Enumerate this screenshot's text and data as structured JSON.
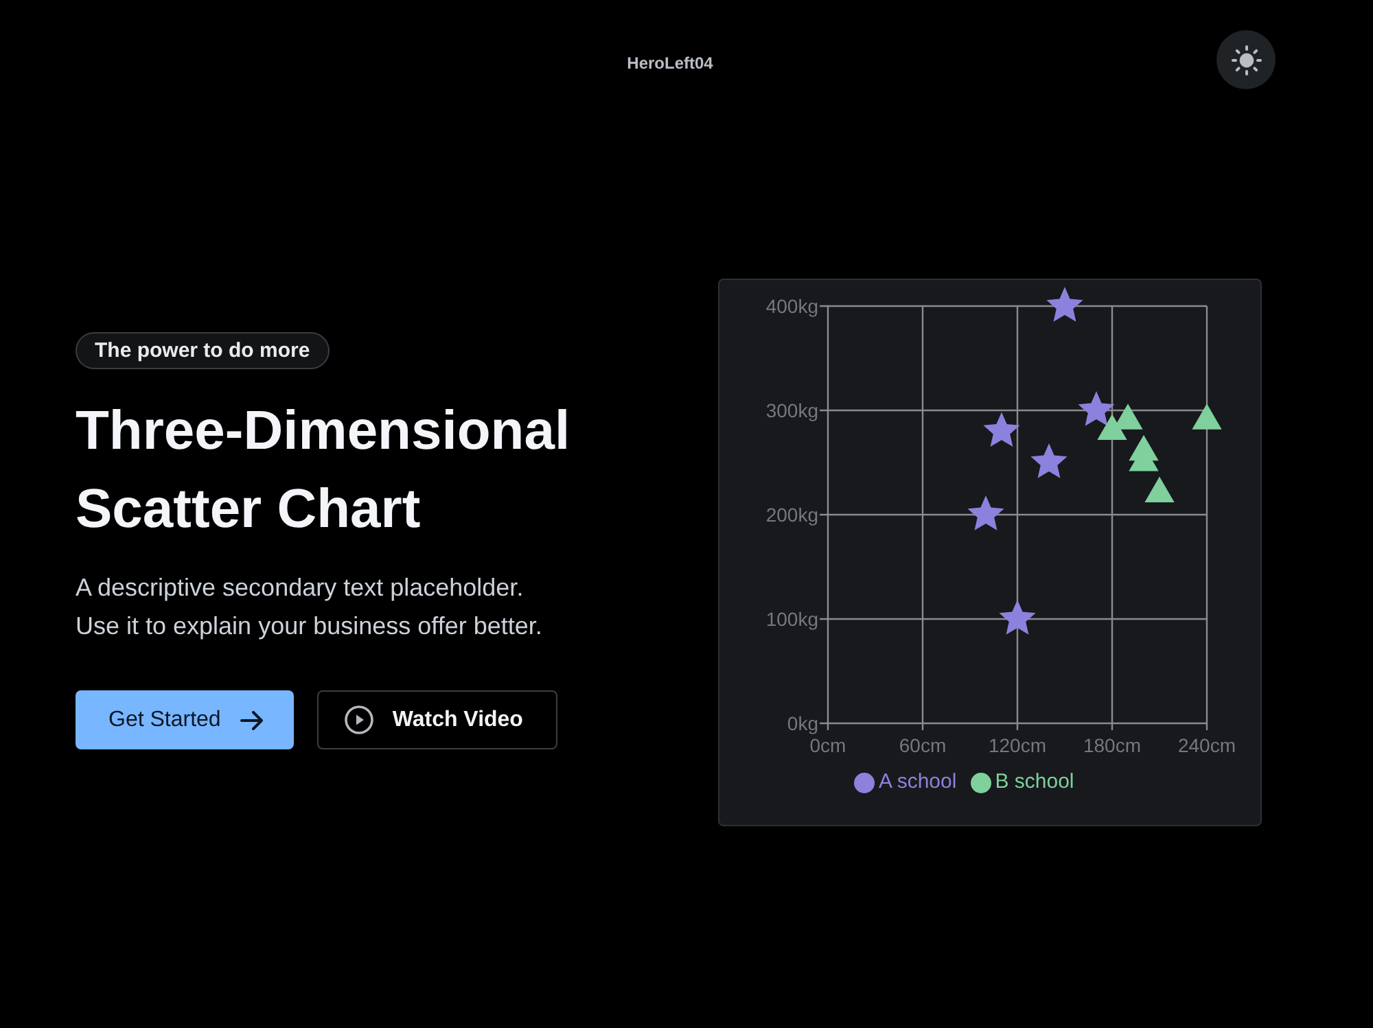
{
  "header": {
    "title": "HeroLeft04"
  },
  "hero": {
    "badge": "The power to do more",
    "title": "Three-Dimensional Scatter Chart",
    "subtitle": "A descriptive secondary text placeholder. Use it to explain your business offer better.",
    "buttons": [
      {
        "label": "Get Started",
        "kind": "primary"
      },
      {
        "label": "Watch Video",
        "kind": "secondary"
      }
    ]
  },
  "chart": {
    "chart_data": [
      {
        "type": "scatter",
        "series": [
          {
            "name": "A school",
            "color": "#8b82dd",
            "marker": "star",
            "x": [
              150,
              170,
              110,
              140,
              100,
              120
            ],
            "values": [
              400,
              300,
              280,
              250,
              200,
              100
            ]
          },
          {
            "name": "B school",
            "color": "#7fd09c",
            "marker": "triangle",
            "x": [
              180,
              190,
              200,
              200,
              210,
              240
            ],
            "values": [
              280,
              290,
              260,
              250,
              220,
              290
            ]
          }
        ],
        "xlim": [
          0,
          240
        ],
        "ylim": [
          0,
          400
        ],
        "xticks": [
          {
            "value": 0,
            "label": "0cm"
          },
          {
            "value": 60,
            "label": "60cm"
          },
          {
            "value": 120,
            "label": "120cm"
          },
          {
            "value": 180,
            "label": "180cm"
          },
          {
            "value": 240,
            "label": "240cm"
          }
        ],
        "yticks": [
          {
            "value": 0,
            "label": "0kg"
          },
          {
            "value": 100,
            "label": "100kg"
          },
          {
            "value": 200,
            "label": "200kg"
          },
          {
            "value": 300,
            "label": "300kg"
          },
          {
            "value": 400,
            "label": "400kg"
          }
        ],
        "grid": true,
        "legend": "bottom"
      }
    ]
  }
}
